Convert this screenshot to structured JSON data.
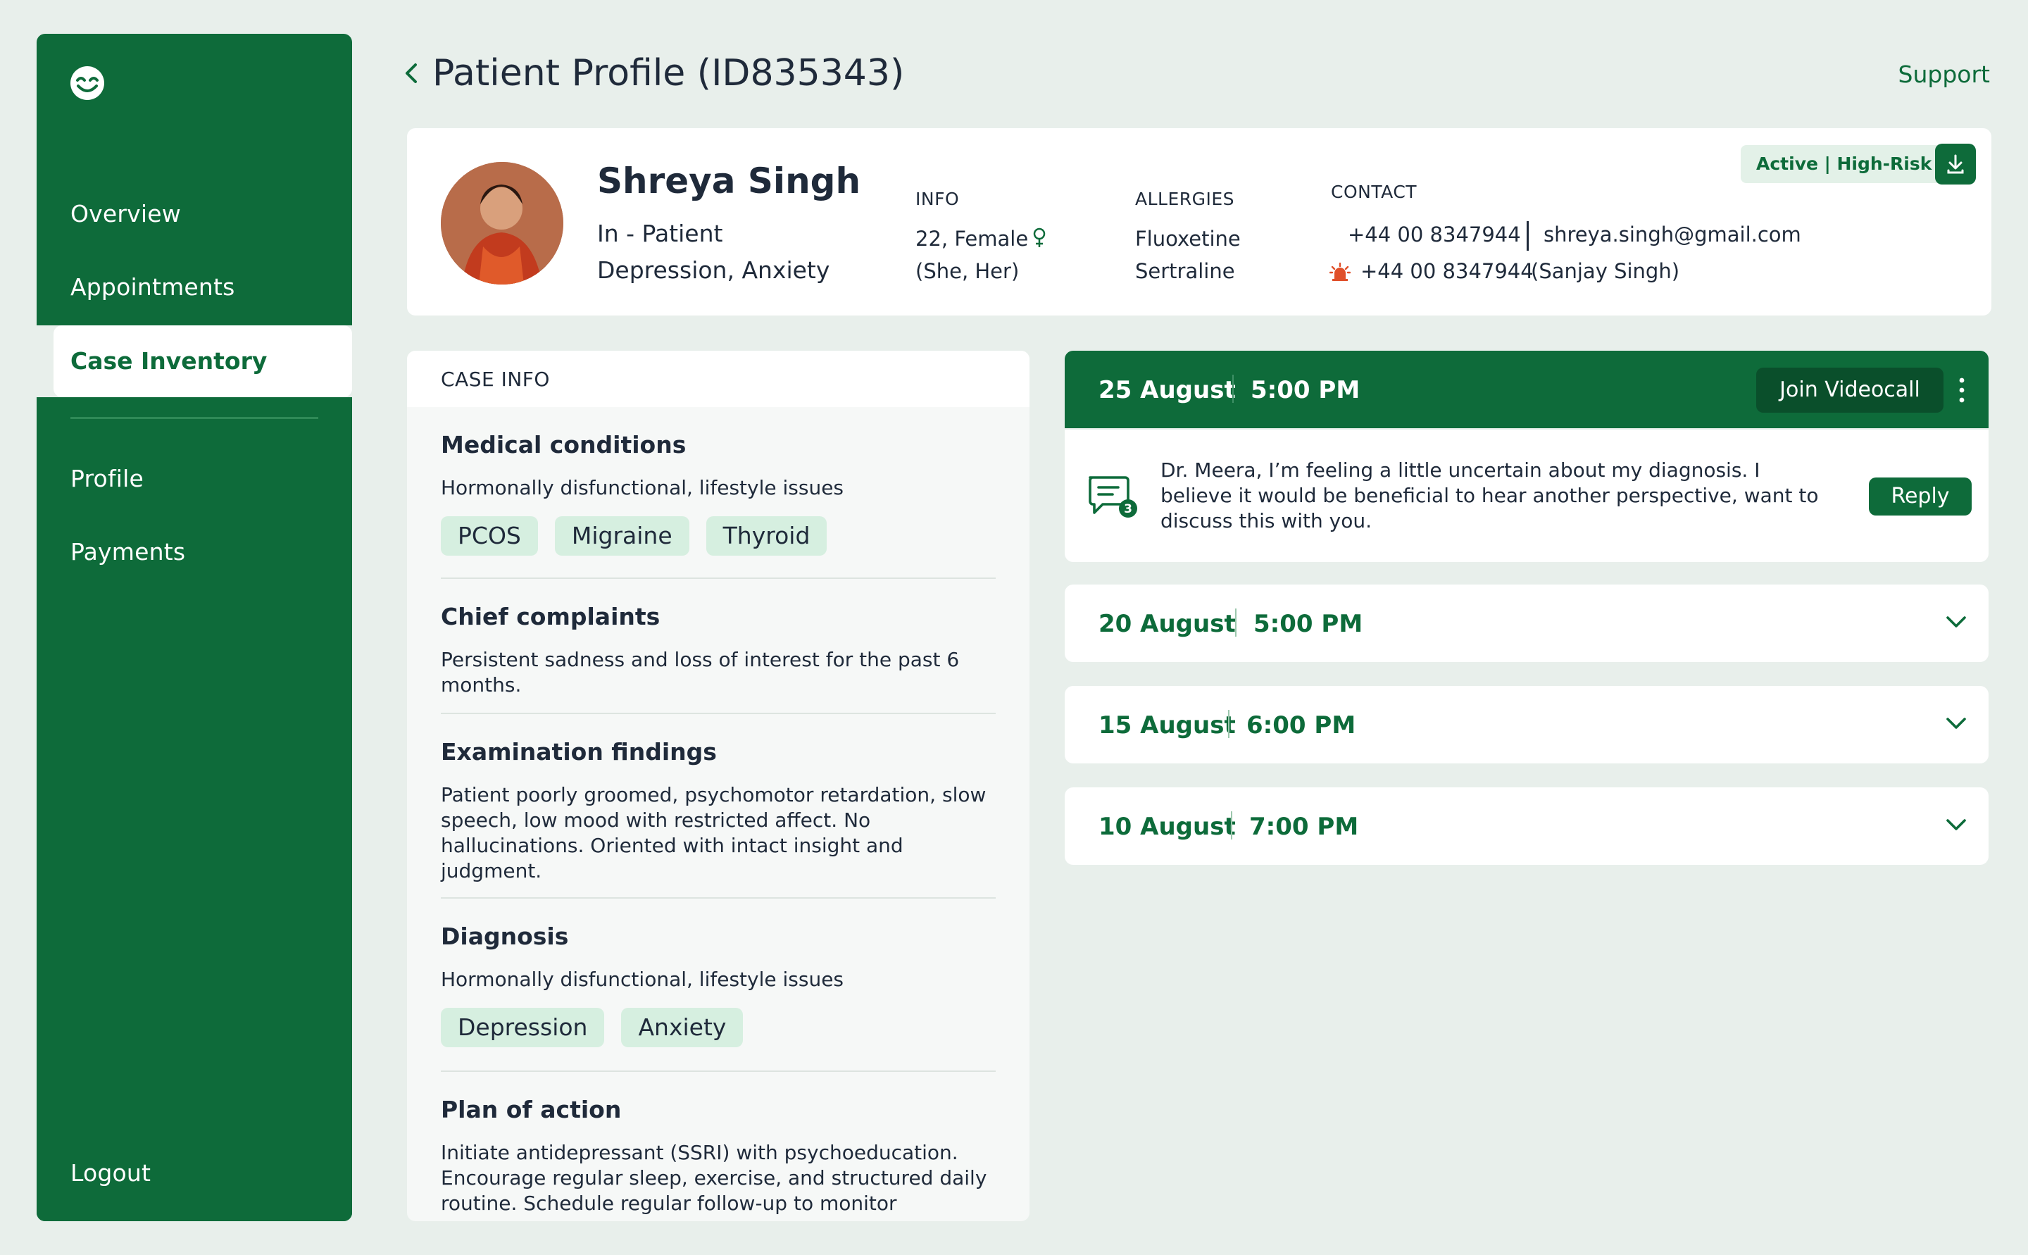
{
  "sidebar": {
    "logo_icon": "smiley-logo-icon",
    "items": [
      {
        "label": "Overview"
      },
      {
        "label": "Appointments"
      },
      {
        "label": "Case Inventory"
      },
      {
        "label": "Profile"
      },
      {
        "label": "Payments"
      }
    ],
    "active_item": "Case Inventory",
    "logout_label": "Logout"
  },
  "header": {
    "title": "Patient Profile (ID835343)",
    "back_icon": "chevron-left-icon",
    "support_label": "Support"
  },
  "patient": {
    "name": "Shreya Singh",
    "status": "In - Patient",
    "conditions": "Depression, Anxiety",
    "info_label": "INFO",
    "age_gender": "22, Female",
    "pronouns": "(She, Her)",
    "allergies_label": "ALLERGIES",
    "allergies": [
      "Fluoxetine",
      "Sertraline"
    ],
    "contact_label": "CONTACT",
    "phone": "+44 00 8347944",
    "email": "shreya.singh@gmail.com",
    "emergency_phone": "+44 00 8347944",
    "emergency_name": "(Sanjay Singh)",
    "badge": "Active | High-Risk"
  },
  "case_info": {
    "heading": "CASE INFO",
    "medical_conditions": {
      "title": "Medical conditions",
      "text": "Hormonally disfunctional, lifestyle issues",
      "tags": [
        "PCOS",
        "Migraine",
        "Thyroid"
      ]
    },
    "chief_complaints": {
      "title": "Chief complaints",
      "text": "Persistent sadness and loss of interest for the past 6 months."
    },
    "examination_findings": {
      "title": "Examination findings",
      "text": "Patient poorly groomed, psychomotor retardation, slow speech, low mood with restricted affect. No hallucinations. Oriented with intact insight and judgment."
    },
    "diagnosis": {
      "title": "Diagnosis",
      "text": "Hormonally disfunctional, lifestyle issues",
      "tags": [
        "Depression",
        "Anxiety"
      ]
    },
    "plan_of_action": {
      "title": "Plan of action",
      "text": "Initiate antidepressant (SSRI) with psychoeducation. Encourage regular sleep, exercise, and structured daily routine. Schedule regular follow-up to monitor"
    }
  },
  "appointments": {
    "active": {
      "date": "25 August",
      "time": "5:00 PM",
      "join_label": "Join Videocall",
      "message": "Dr. Meera, I’m feeling a little uncertain about my diagnosis. I believe it would be beneficial to hear another perspective, want to discuss this with you.",
      "message_count": "3",
      "reply_label": "Reply"
    },
    "past": [
      {
        "date": "20 August",
        "time": "5:00 PM"
      },
      {
        "date": "15 August",
        "time": "6:00 PM"
      },
      {
        "date": "10 August",
        "time": "7:00 PM"
      }
    ]
  },
  "colors": {
    "primary": "#0e6b3a",
    "background": "#e8efeb",
    "chip": "#d6efe0",
    "badge_bg": "#e3f1e8",
    "emergency": "#e0502a"
  }
}
